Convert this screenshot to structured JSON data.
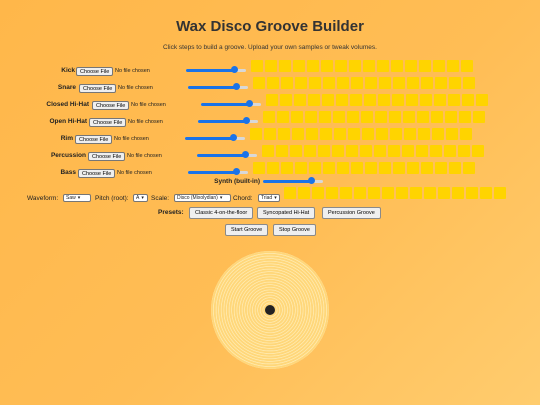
{
  "title": "Wax Disco Groove Builder",
  "subtitle": "Click steps to build a groove. Upload your own samples or tweak volumes.",
  "tracks": [
    {
      "label": "Kick",
      "file_button": "Choose File",
      "file_text": "No file chosen",
      "volume": 0.8
    },
    {
      "label": "Snare",
      "file_button": "Choose File",
      "file_text": "No file chosen",
      "volume": 0.8
    },
    {
      "label": "Closed Hi-Hat",
      "file_button": "Choose File",
      "file_text": "No file chosen",
      "volume": 0.8
    },
    {
      "label": "Open Hi-Hat",
      "file_button": "Choose File",
      "file_text": "No file chosen",
      "volume": 0.8
    },
    {
      "label": "Rim",
      "file_button": "Choose File",
      "file_text": "No file chosen",
      "volume": 0.8
    },
    {
      "label": "Percussion",
      "file_button": "Choose File",
      "file_text": "No file chosen",
      "volume": 0.8
    },
    {
      "label": "Bass",
      "file_button": "Choose File",
      "file_text": "No file chosen",
      "volume": 0.8
    }
  ],
  "synth": {
    "label": "Synth (built-in)",
    "volume": 0.8
  },
  "controls": {
    "waveform_label": "Waveform:",
    "waveform_value": "Saw",
    "pitch_label": "Pitch (root):",
    "pitch_value": "A",
    "scale_label": "Scale:",
    "scale_value": "Disco (Mixolydian)",
    "chord_label": "Chord:",
    "chord_value": "Triad"
  },
  "presets": {
    "label": "Presets:",
    "buttons": [
      "Classic 4-on-the-floor",
      "Syncopated Hi-Hat",
      "Percussion Groove"
    ]
  },
  "transport": {
    "start": "Start Groove",
    "stop": "Stop Groove"
  },
  "colors": {
    "step": "#ffd400",
    "accent": "#1a73e8",
    "background": "#ffb74a"
  }
}
